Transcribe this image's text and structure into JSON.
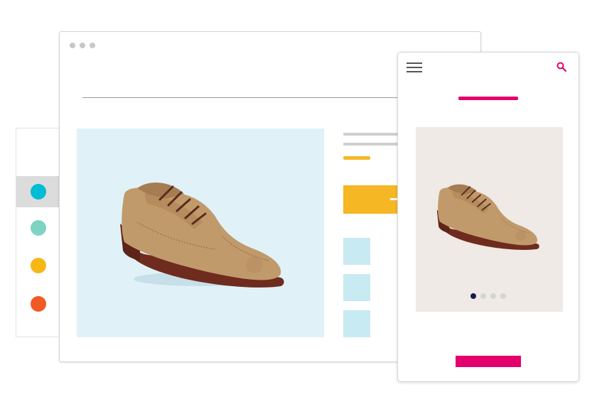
{
  "colors": {
    "accent_pink": "#e3006d",
    "accent_yellow": "#f5b724",
    "hero_background": "#e0f2f8",
    "mobile_image_background": "#efeae5",
    "thumbnail": "#c8eaf3",
    "shoe_upper": "#c19a6b",
    "shoe_sole": "#6e2b1e",
    "shoe_laces": "#5a2a1c"
  },
  "color_options": [
    {
      "color": "#00bcd4",
      "selected": true
    },
    {
      "color": "#7fd3c2",
      "selected": false
    },
    {
      "color": "#f7b716",
      "selected": false
    },
    {
      "color": "#f15a24",
      "selected": false
    }
  ],
  "desktop": {
    "window_controls": [
      "dot-icon",
      "dot-icon",
      "dot-icon"
    ],
    "thumbnails": 3
  },
  "mobile": {
    "icons": {
      "menu": "hamburger-icon",
      "search": "search-icon"
    },
    "carousel": {
      "count": 4,
      "active": 0
    }
  }
}
